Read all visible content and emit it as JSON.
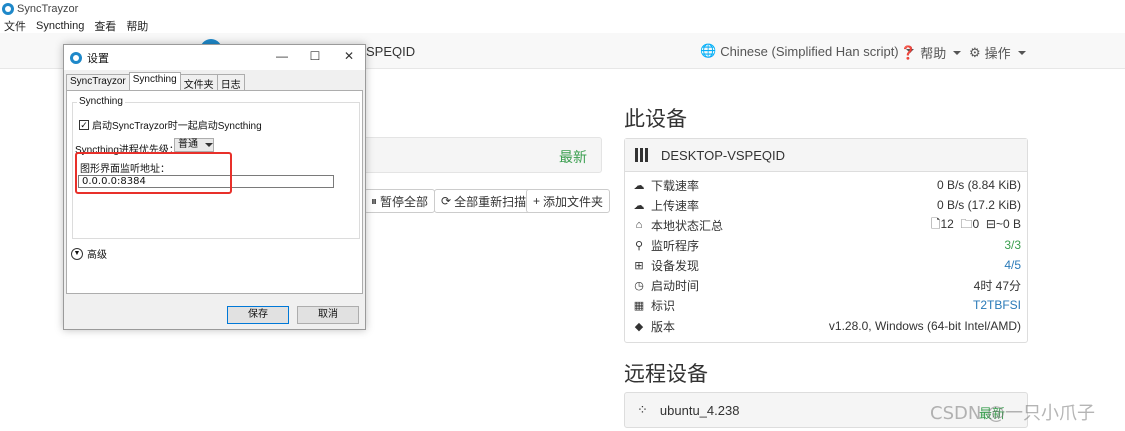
{
  "window": {
    "title": "SyncTrayzor"
  },
  "menubar": [
    "文件",
    "Syncthing",
    "查看",
    "帮助"
  ],
  "navbar": {
    "device_name": "SPEQID",
    "language": "Chinese (Simplified Han script)",
    "help": "帮助",
    "actions": "操作"
  },
  "folders": {
    "status": "最新"
  },
  "folder_buttons": {
    "pause_all": "暂停全部",
    "rescan_all": "全部重新扫描",
    "add_folder": "添加文件夹"
  },
  "this_device": {
    "section_title": "此设备",
    "name": "DESKTOP-VSPEQID",
    "rows": [
      {
        "label": "下载速率",
        "value": "0 B/s (8.84 KiB)",
        "icon": "cloud-download-icon"
      },
      {
        "label": "上传速率",
        "value": "0 B/s (17.2 KiB)",
        "icon": "cloud-upload-icon"
      },
      {
        "label": "本地状态汇总",
        "value": "",
        "icon": "home-icon"
      },
      {
        "label": "监听程序",
        "value": "3/3",
        "icon": "sitemap-icon"
      },
      {
        "label": "设备发现",
        "value": "4/5",
        "icon": "signpost-icon"
      },
      {
        "label": "启动时间",
        "value": "4时 47分",
        "icon": "clock-icon"
      },
      {
        "label": "标识",
        "value": "T2TBFSI",
        "icon": "qrcode-icon"
      },
      {
        "label": "版本",
        "value": "v1.28.0, Windows (64-bit Intel/AMD)",
        "icon": "tag-icon"
      }
    ],
    "local_state": {
      "files": "12",
      "dirs": "0",
      "size": "~0 B"
    }
  },
  "remote_devices": {
    "section_title": "远程设备",
    "items": [
      {
        "name": "ubuntu_4.238",
        "status": "最新"
      }
    ]
  },
  "dialog": {
    "title": "设置",
    "tabs": [
      "SyncTrayzor",
      "Syncthing",
      "文件夹",
      "日志"
    ],
    "group_title": "Syncthing",
    "autostart_label": "启动SyncTrayzor时一起启动Syncthing",
    "priority_label": "Syncthing进程优先级：",
    "priority_value": "普通",
    "gui_address_label": "图形界面监听地址：",
    "gui_address_value": "0.0.0.0:8384",
    "advanced_label": "高级",
    "save_label": "保存",
    "cancel_label": "取消"
  },
  "watermark": "CSDN @一只小爪子",
  "colors": {
    "accent_blue": "#1e88c9",
    "status_green": "#3a9e4f",
    "highlight_red": "#e8302a",
    "link_blue": "#2a7ab8"
  }
}
